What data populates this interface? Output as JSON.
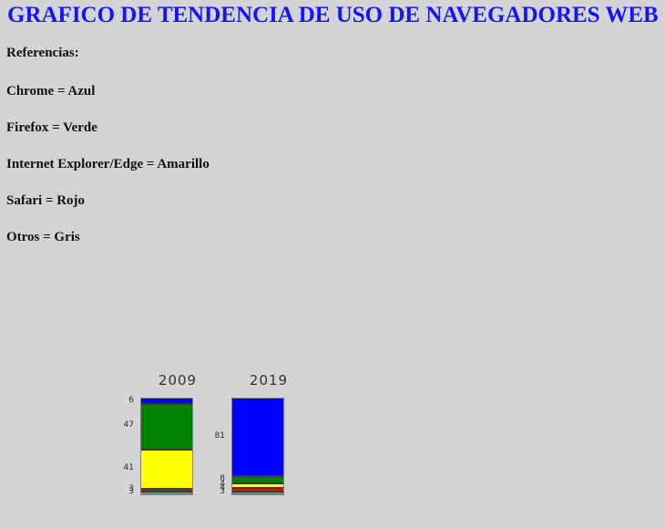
{
  "page": {
    "title": "GRAFICO DE TENDENCIA DE USO DE NAVEGADORES WEB",
    "background_color": "#d4d4d4",
    "title_color": "#1414ff"
  },
  "legend": {
    "heading": "Referencias:",
    "entries": [
      "Chrome = Azul",
      "Firefox = Verde",
      "Internet Explorer/Edge = Amarillo",
      "Safari = Rojo",
      "Otros = Gris"
    ]
  },
  "chart_data": {
    "type": "bar",
    "subtype": "stacked-100",
    "title": "GRAFICO DE TENDENCIA DE USO DE NAVEGADORES WEB",
    "xlabel": "",
    "ylabel": "",
    "ylim": [
      0,
      100
    ],
    "grid": false,
    "legend_position": "top-left-text",
    "categories": [
      "2009",
      "2019"
    ],
    "series": [
      {
        "name": "Chrome",
        "color": "#0000ff",
        "values": [
          6,
          81
        ]
      },
      {
        "name": "Firefox",
        "color": "#008000",
        "values": [
          47,
          8
        ]
      },
      {
        "name": "Internet Explorer/Edge",
        "color": "#ffff00",
        "values": [
          41,
          4
        ]
      },
      {
        "name": "Safari",
        "color": "#ff0000",
        "values": [
          3,
          4
        ]
      },
      {
        "name": "Otros",
        "color": "#808080",
        "values": [
          3,
          3
        ]
      }
    ],
    "bars": [
      {
        "category": "2009",
        "segments": [
          {
            "name": "Chrome",
            "value": 6,
            "label": "6",
            "color": "#0000ff"
          },
          {
            "name": "Firefox",
            "value": 47,
            "label": "47",
            "color": "#008000"
          },
          {
            "name": "Internet Explorer/Edge",
            "value": 41,
            "label": "41",
            "color": "#ffff00"
          },
          {
            "name": "Safari",
            "value": 3,
            "label": "3",
            "color": "#ff0000"
          },
          {
            "name": "Otros",
            "value": 3,
            "label": "3",
            "color": "#808080"
          }
        ]
      },
      {
        "category": "2019",
        "segments": [
          {
            "name": "Chrome",
            "value": 81,
            "label": "81",
            "color": "#0000ff"
          },
          {
            "name": "Firefox",
            "value": 8,
            "label": "8",
            "color": "#008000"
          },
          {
            "name": "Internet Explorer/Edge",
            "value": 4,
            "label": "4",
            "color": "#ffff00"
          },
          {
            "name": "Safari",
            "value": 4,
            "label": "4",
            "color": "#ff0000"
          },
          {
            "name": "Otros",
            "value": 3,
            "label": "3",
            "color": "#808080"
          }
        ]
      }
    ]
  }
}
